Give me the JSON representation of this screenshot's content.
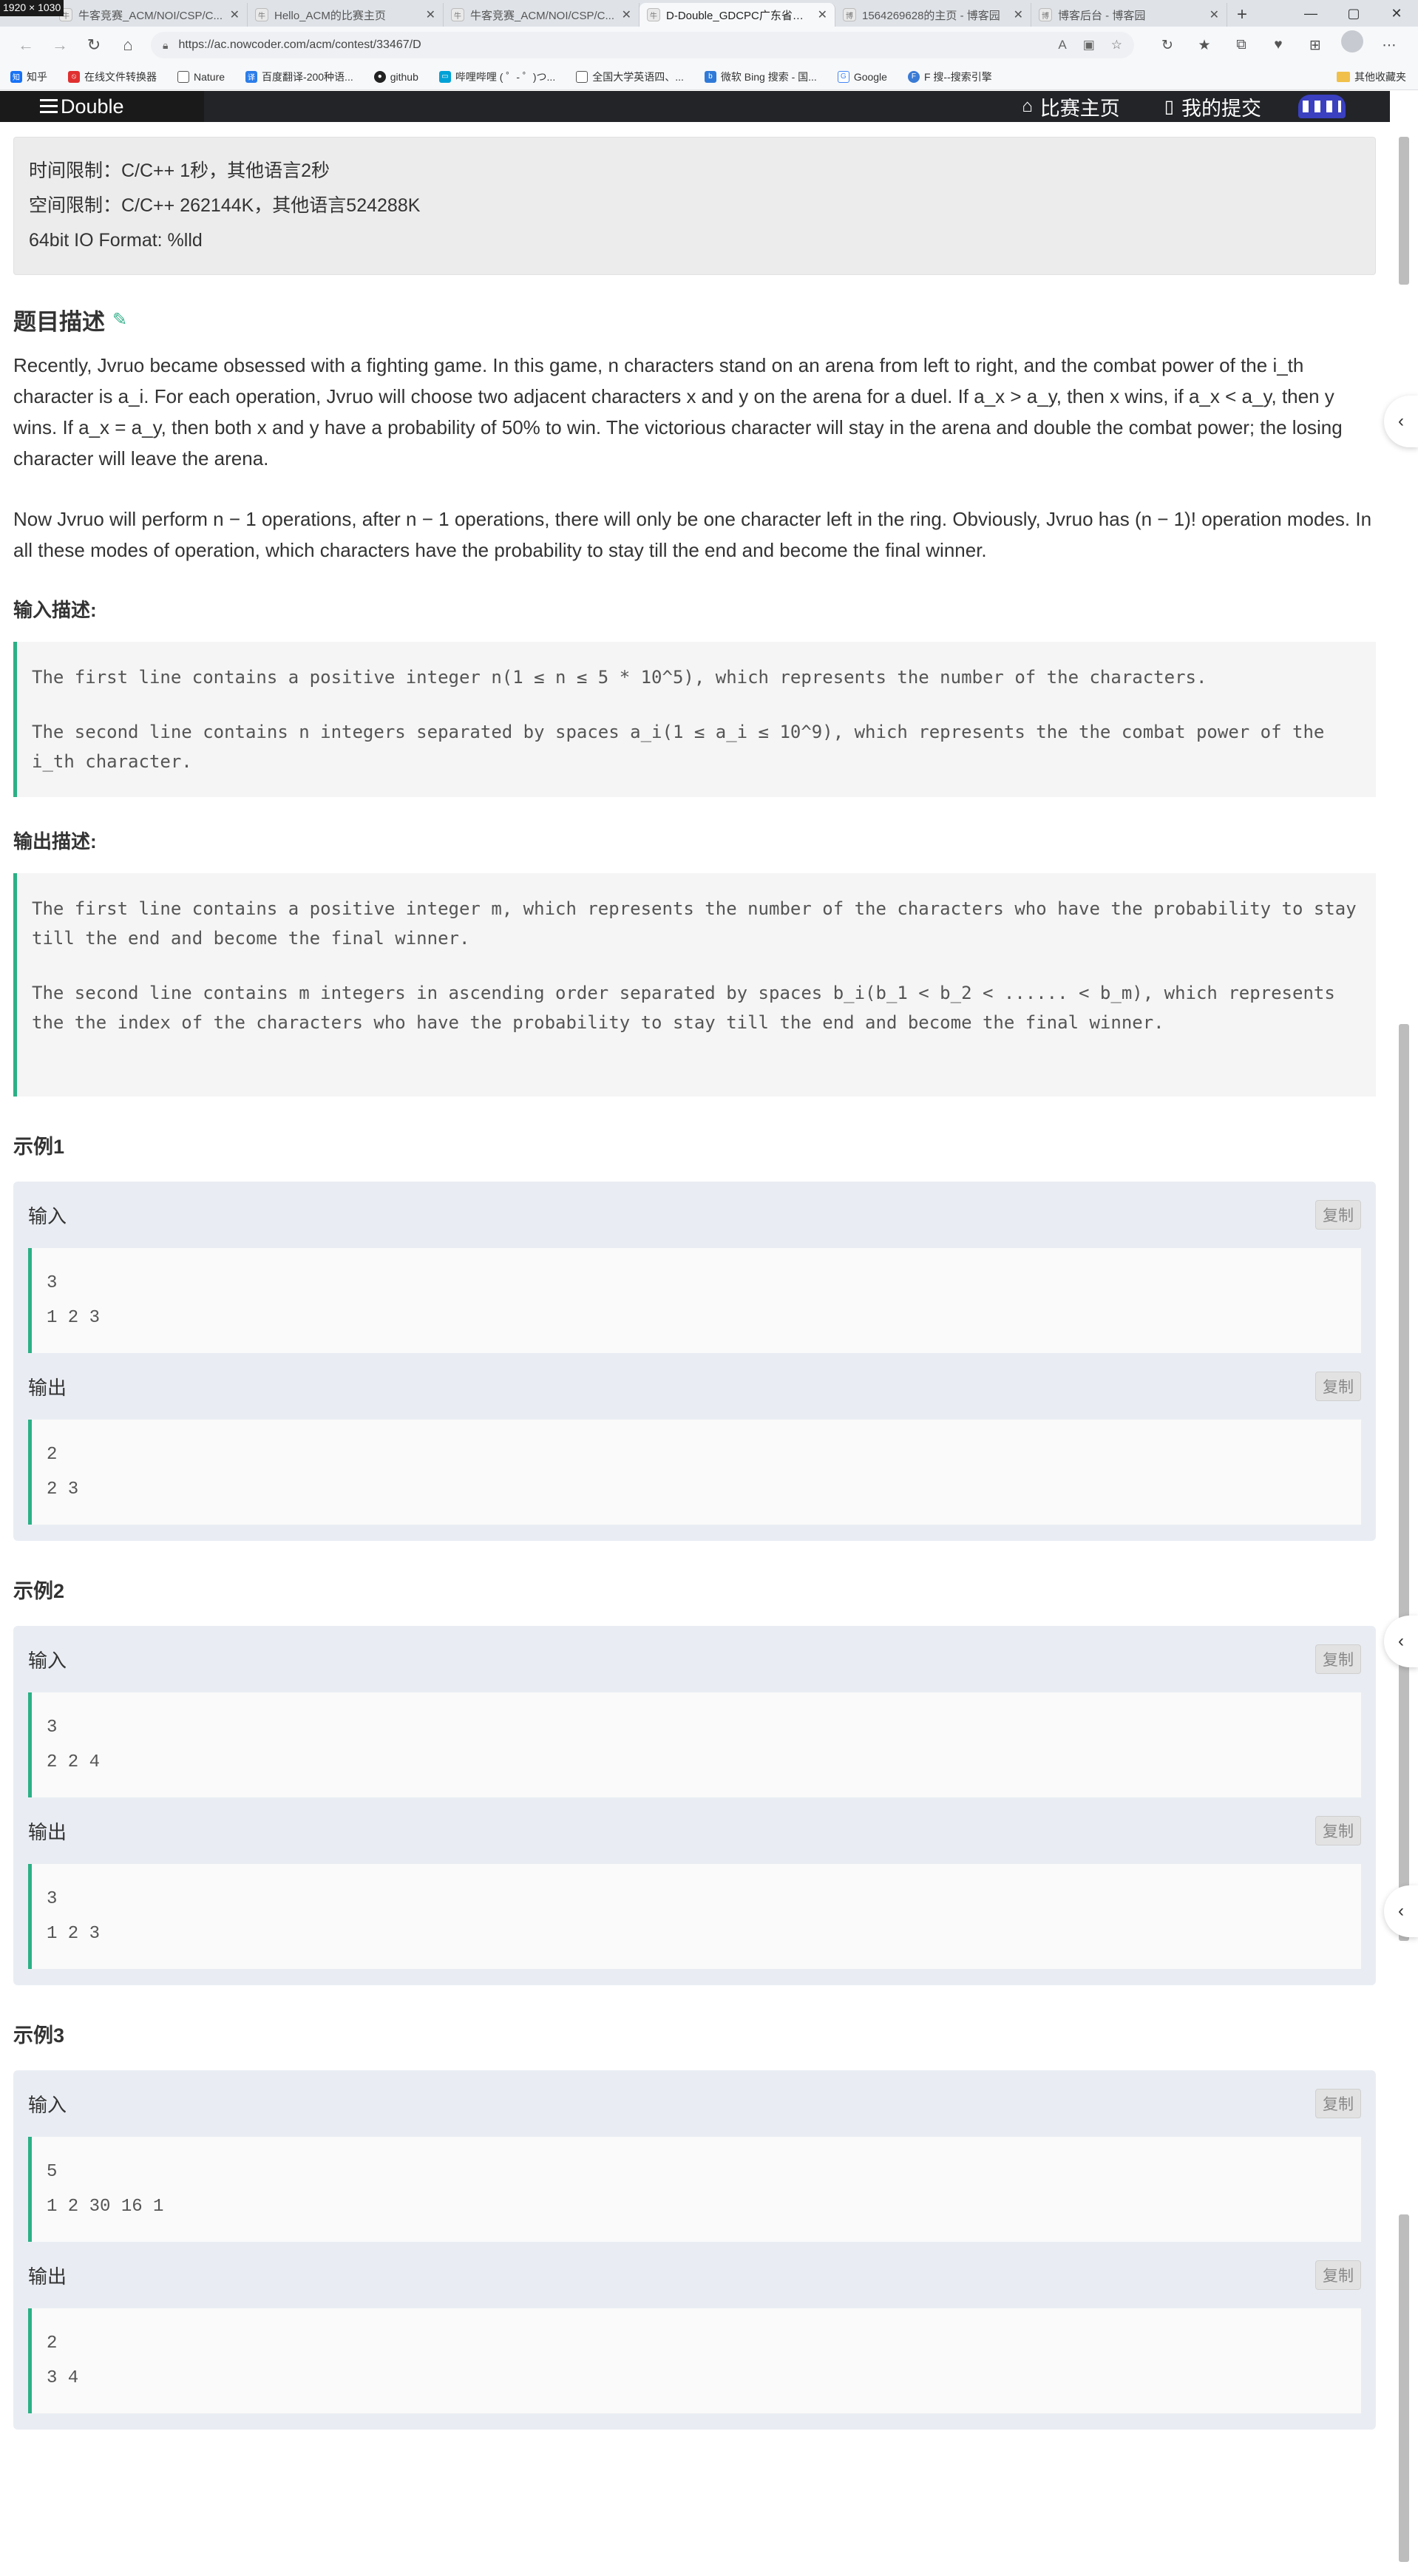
{
  "browser": {
    "resolution_badge": "1920 × 1030",
    "tabs": [
      {
        "label": "牛客竞赛_ACM/NOI/CSP/C...",
        "active": false
      },
      {
        "label": "Hello_ACM的比赛主页",
        "active": false
      },
      {
        "label": "牛客竞赛_ACM/NOI/CSP/C...",
        "active": false
      },
      {
        "label": "D-Double_GDCPC广东省大...",
        "active": true
      },
      {
        "label": "1564269628的主页 - 博客园",
        "active": false
      },
      {
        "label": "博客后台 - 博客园",
        "active": false
      }
    ],
    "url": "https://ac.nowcoder.com/acm/contest/33467/D",
    "bookmarks": [
      {
        "label": "知乎",
        "color": "#1772f6"
      },
      {
        "label": "在线文件转换器",
        "color": "#e03030"
      },
      {
        "label": "Nature",
        "color": "#555555"
      },
      {
        "label": "百度翻译-200种语...",
        "color": "#2b7de9"
      },
      {
        "label": "github",
        "color": "#222222"
      },
      {
        "label": "哔哩哔哩 ( ゜- ゜)つ...",
        "color": "#00a1d6"
      },
      {
        "label": "全国大学英语四、...",
        "color": "#555555"
      },
      {
        "label": "微软 Bing 搜索 - 国...",
        "color": "#2f7ad8"
      },
      {
        "label": "Google",
        "color": "#4285f4"
      },
      {
        "label": "F 搜--搜索引擎",
        "color": "#3a7bd5"
      }
    ],
    "bookmarks_folder": "其他收藏夹"
  },
  "header": {
    "brand": "Double",
    "nav": [
      {
        "label": "比赛主页",
        "icon": "home-icon"
      },
      {
        "label": "我的提交",
        "icon": "document-icon"
      }
    ]
  },
  "limits": {
    "time": "时间限制：C/C++ 1秒，其他语言2秒",
    "space": "空间限制：C/C++ 262144K，其他语言524288K",
    "io": "64bit IO Format: %lld"
  },
  "description": {
    "title": "题目描述",
    "p1": "Recently, Jvruo became obsessed with a fighting game. In this game, n characters stand on an arena from left to right, and the combat power of the i_th character is a_i. For each operation, Jvruo will choose two adjacent characters x and y on the arena for a duel. If a_x > a_y, then x wins, if a_x < a_y, then y wins. If a_x = a_y, then both x and y have a probability of 50% to win. The victorious character will stay in the arena and double the combat power; the losing character will leave the arena.",
    "p2": "Now Jvruo will perform n − 1 operations, after n − 1 operations, there will only be one character left in the ring. Obviously, Jvruo has (n − 1)! operation modes. In all these modes of operation, which characters have the probability to stay till the end and become the final winner."
  },
  "input": {
    "title": "输入描述:",
    "line1": "The first line contains a positive integer n(1 ≤ n ≤ 5 * 10^5), which represents the number of the characters.",
    "line2": "The second line contains n integers separated by spaces a_i(1 ≤ a_i ≤ 10^9), which represents the the combat power of the i_th character."
  },
  "output": {
    "title": "输出描述:",
    "line1": "The first line contains a positive integer m, which represents the number of the characters who have the probability to stay till the end and become the final winner.",
    "line2": "The second line contains m integers in ascending order separated by spaces b_i(b_1 < b_2 < ...... < b_m), which represents the the index of the characters who have the probability to stay till the end and become the final winner."
  },
  "examples": [
    {
      "title": "示例1",
      "input_label": "输入",
      "output_label": "输出",
      "copy": "复制",
      "input": [
        "3",
        "1 2 3"
      ],
      "output": [
        "2",
        "2 3"
      ]
    },
    {
      "title": "示例2",
      "input_label": "输入",
      "output_label": "输出",
      "copy": "复制",
      "input": [
        "3",
        "2 2 4"
      ],
      "output": [
        "3",
        "1 2 3"
      ]
    },
    {
      "title": "示例3",
      "input_label": "输入",
      "output_label": "输出",
      "copy": "复制",
      "input": [
        "5",
        "1 2 30 16 1"
      ],
      "output": [
        "2",
        "3 4"
      ]
    }
  ]
}
